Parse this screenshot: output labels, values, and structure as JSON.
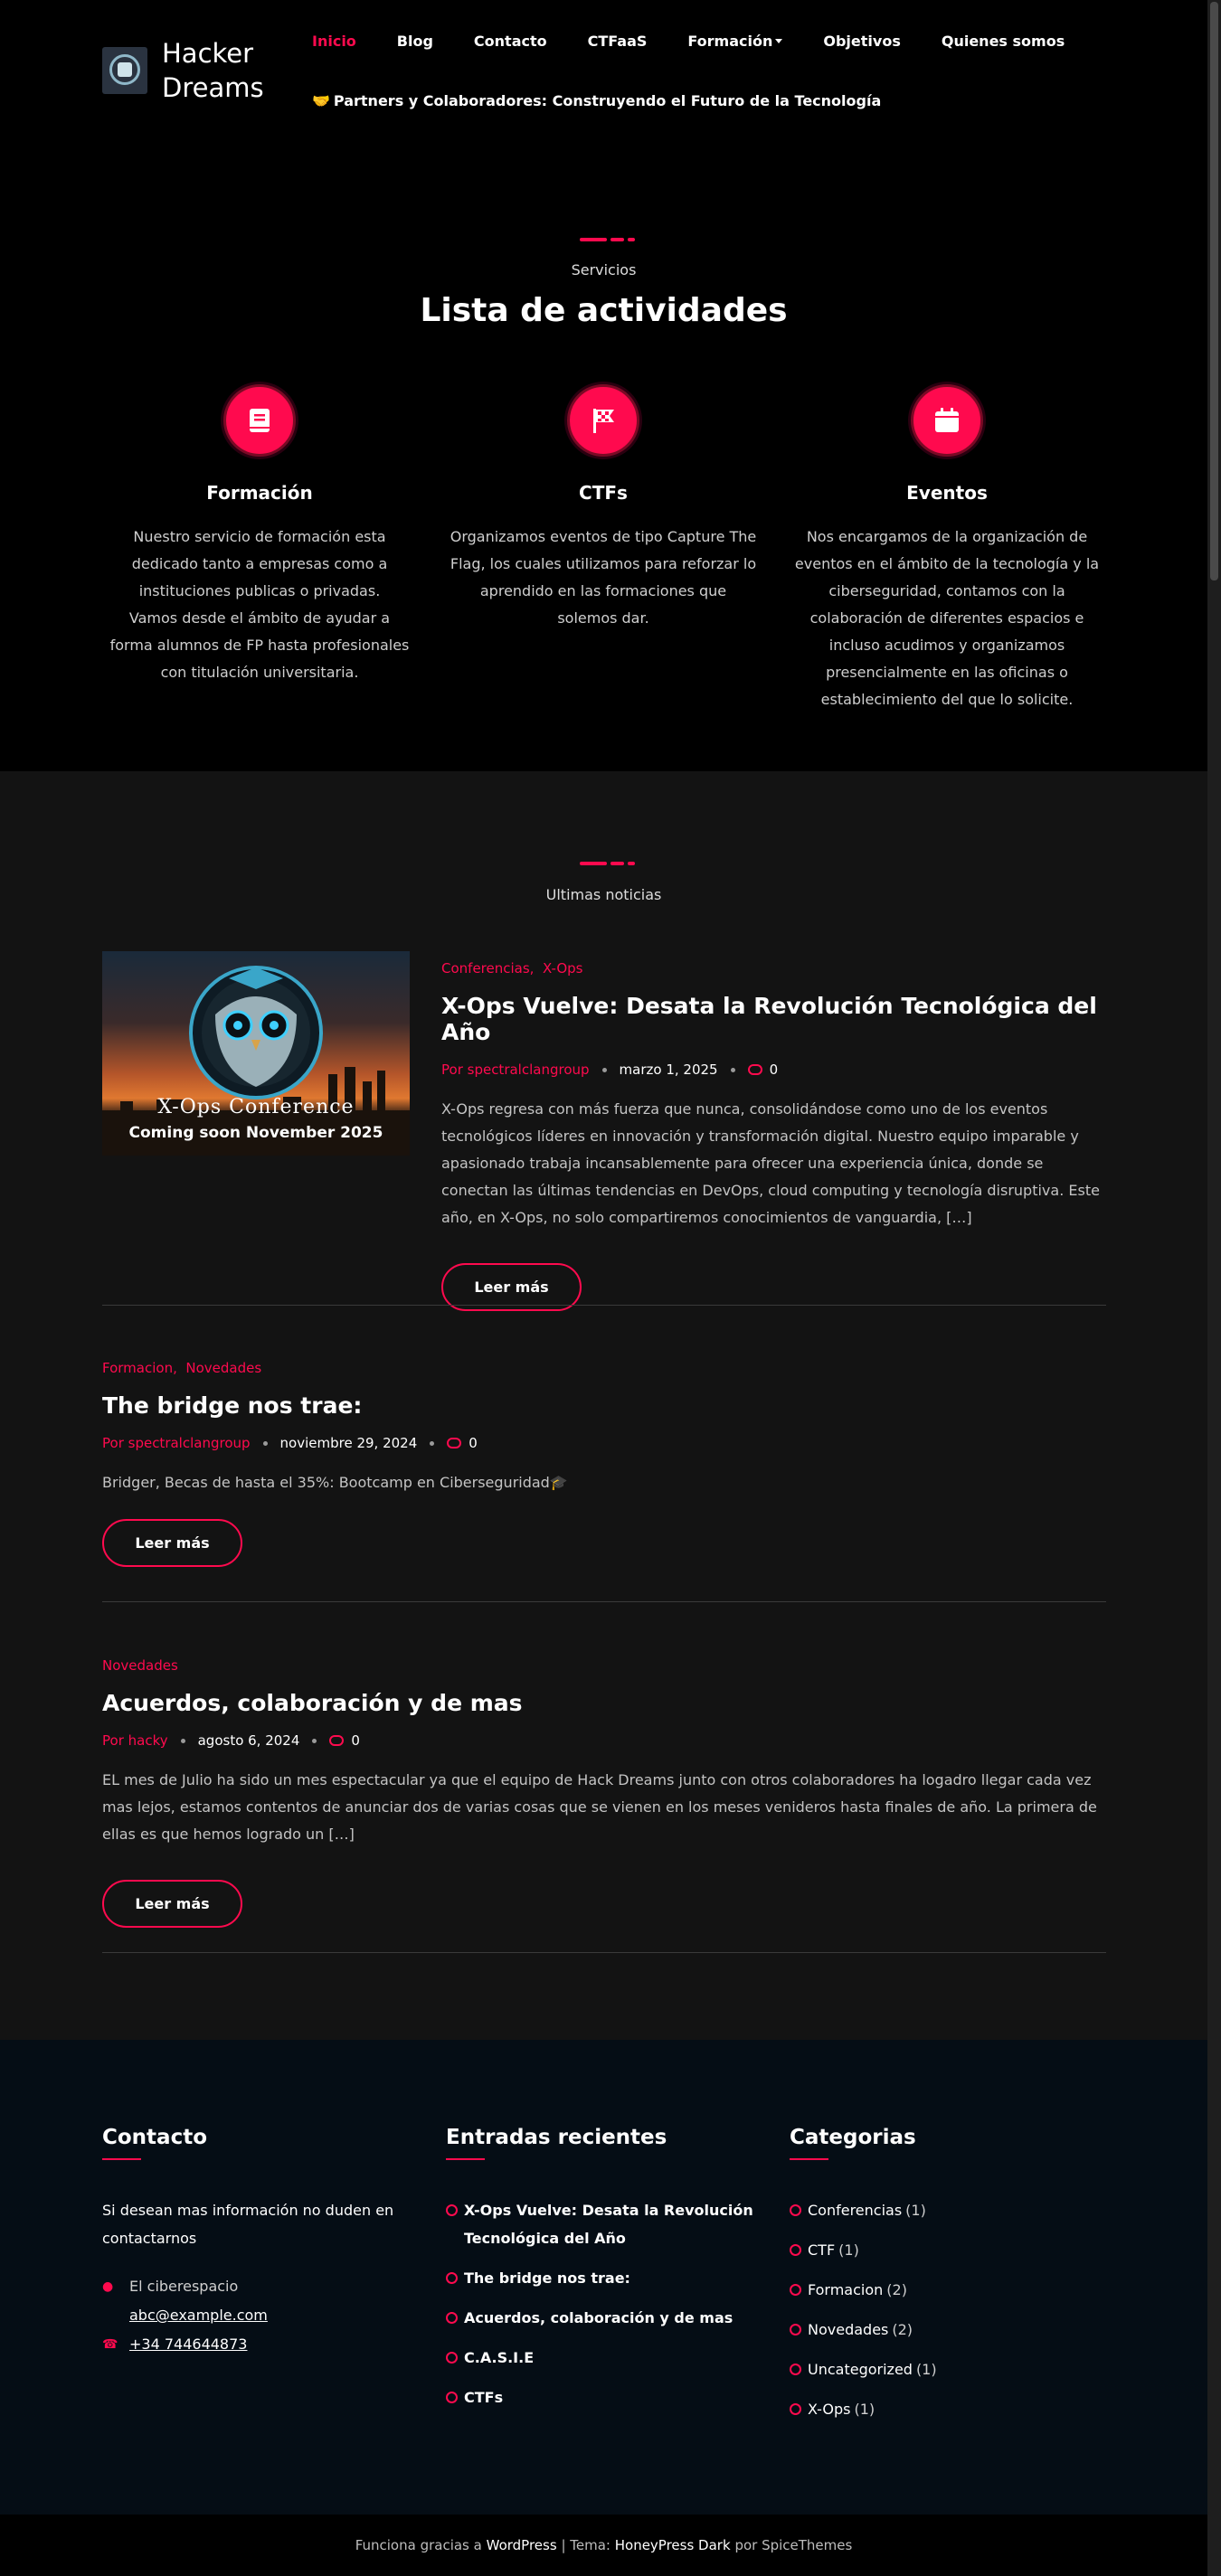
{
  "header": {
    "site_title": "Hacker Dreams",
    "nav": [
      "Inicio",
      "Blog",
      "Contacto",
      "CTFaaS",
      "Formación",
      "Objetivos",
      "Quienes somos"
    ],
    "nav_second": "Partners y Colaboradores: Construyendo el Futuro de la Tecnología",
    "nav_second_emoji": "🤝"
  },
  "services": {
    "label": "Servicios",
    "title": "Lista de actividades",
    "items": [
      {
        "title": "Formación",
        "text": "Nuestro servicio de formación esta dedicado tanto a empresas como a instituciones publicas o privadas.\nVamos desde el ámbito de ayudar a forma alumnos de FP hasta profesionales con titulación universitaria.",
        "icon": "book-icon"
      },
      {
        "title": "CTFs",
        "text": "Organizamos eventos de tipo Capture The Flag, los cuales utilizamos para reforzar lo aprendido en las formaciones que solemos dar.",
        "icon": "flag-icon"
      },
      {
        "title": "Eventos",
        "text": "Nos encargamos de la organización de eventos en el ámbito de la tecnología y la ciberseguridad, contamos con la colaboración de diferentes espacios e incluso acudimos y organizamos presencialmente en las oficinas o establecimiento del que lo solicite.",
        "icon": "calendar-icon"
      }
    ]
  },
  "news": {
    "label": "Ultimas noticias",
    "read_more": "Leer más",
    "posts": [
      {
        "cat1": "Conferencias",
        "cat2": "X-Ops",
        "title": "X-Ops Vuelve: Desata la Revolución Tecnológica del Año",
        "author": "Por spectralclangroup",
        "date": "marzo 1, 2025",
        "comments": "0",
        "excerpt": "X-Ops regresa con más fuerza que nunca, consolidándose como uno de los eventos tecnológicos líderes en innovación y transformación digital. Nuestro equipo imparable y apasionado trabaja incansablemente para ofrecer una experiencia única, donde se conectan las últimas tendencias en DevOps, cloud computing y tecnología disruptiva. Este año, en X-Ops, no solo compartiremos conocimientos de vanguardia, […]",
        "image_caption_1": "X-Ops Conference",
        "image_caption_2": "Coming soon November 2025"
      },
      {
        "cat1": "Formacion",
        "cat2": "Novedades",
        "title": "The bridge nos trae:",
        "author": "Por spectralclangroup",
        "date": "noviembre 29, 2024",
        "comments": "0",
        "excerpt": "Bridger, Becas de hasta el 35%: Bootcamp en Ciberseguridad🎓"
      },
      {
        "cat1": "Novedades",
        "title": "Acuerdos, colaboración y de mas",
        "author": "Por hacky",
        "date": "agosto 6, 2024",
        "comments": "0",
        "excerpt": "EL mes de Julio ha sido un mes espectacular ya que el equipo de Hack Dreams junto con otros colaboradores ha logadro llegar cada vez mas lejos, estamos contentos de anunciar dos de varias cosas que se vienen en los meses venideros hasta finales de año. La primera de ellas es que hemos logrado un […]"
      }
    ]
  },
  "footer": {
    "contact": {
      "title": "Contacto",
      "intro": "Si desean mas información no duden en contactarnos",
      "place": "El ciberespacio",
      "email": "abc@example.com",
      "phone": "+34 744644873"
    },
    "recent": {
      "title": "Entradas recientes",
      "items": [
        "X-Ops Vuelve: Desata la Revolución Tecnológica del Año",
        "The bridge nos trae:",
        "Acuerdos, colaboración y de mas",
        "C.A.S.I.E",
        "CTFs"
      ]
    },
    "categories": {
      "title": "Categorias",
      "items": [
        {
          "name": "Conferencias",
          "count": "(1)"
        },
        {
          "name": "CTF",
          "count": "(1)"
        },
        {
          "name": "Formacion",
          "count": "(2)"
        },
        {
          "name": "Novedades",
          "count": "(2)"
        },
        {
          "name": "Uncategorized",
          "count": "(1)"
        },
        {
          "name": "X-Ops",
          "count": "(1)"
        }
      ]
    }
  },
  "bottom": {
    "powered": "Funciona gracias a",
    "wordpress": "WordPress",
    "sep": " | Tema: ",
    "theme": "HoneyPress Dark",
    "by": "por SpiceThemes"
  },
  "colors": {
    "accent": "#ff0a4e",
    "page_bg": "#000000",
    "news_bg": "#131313",
    "footer_bg": "#050d15"
  }
}
